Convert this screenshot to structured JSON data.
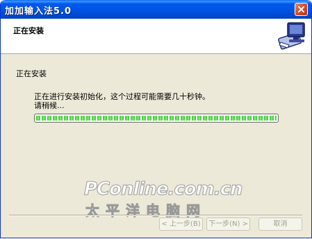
{
  "window": {
    "title": "加加输入法5.0"
  },
  "header": {
    "title": "正在安装",
    "icon": "computer-install-icon"
  },
  "main": {
    "heading": "正在安装",
    "message_line1": "正在进行安装初始化，这个过程可能需要几十秒钟。",
    "message_line2": "请稍候...",
    "progress_percent": 100
  },
  "watermark": {
    "line1": "PConline.com.cn",
    "line2": "太平洋电脑网"
  },
  "buttons": {
    "back": "< 上一步(B)",
    "next": "下一步(N) >",
    "cancel": "取消"
  },
  "colors": {
    "titlebar": "#0054e3",
    "progress": "#37c832",
    "window_bg": "#ece9d8"
  }
}
